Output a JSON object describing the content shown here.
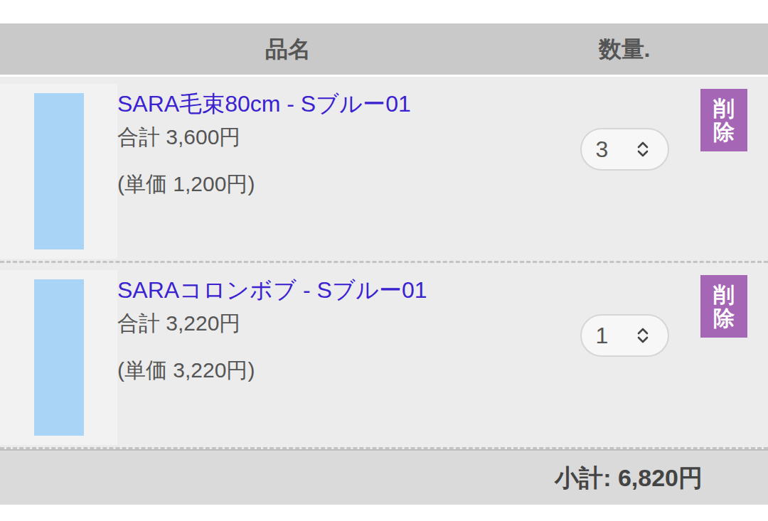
{
  "table": {
    "columns": [
      "品名",
      "数量."
    ]
  },
  "rows": [
    {
      "name": "SARA毛束80cm - Sブルー01",
      "total": "合計 3,600円",
      "unit_price": "(単価 1,200円)",
      "quantity": "3",
      "delete": "削除"
    },
    {
      "name": "SARAコロンボブ - Sブルー01",
      "total": "合計 3,220円",
      "unit_price": "(単価 3,220円)",
      "quantity": "1",
      "delete": "削除"
    }
  ],
  "subtotal": "小計: 6,820円"
}
